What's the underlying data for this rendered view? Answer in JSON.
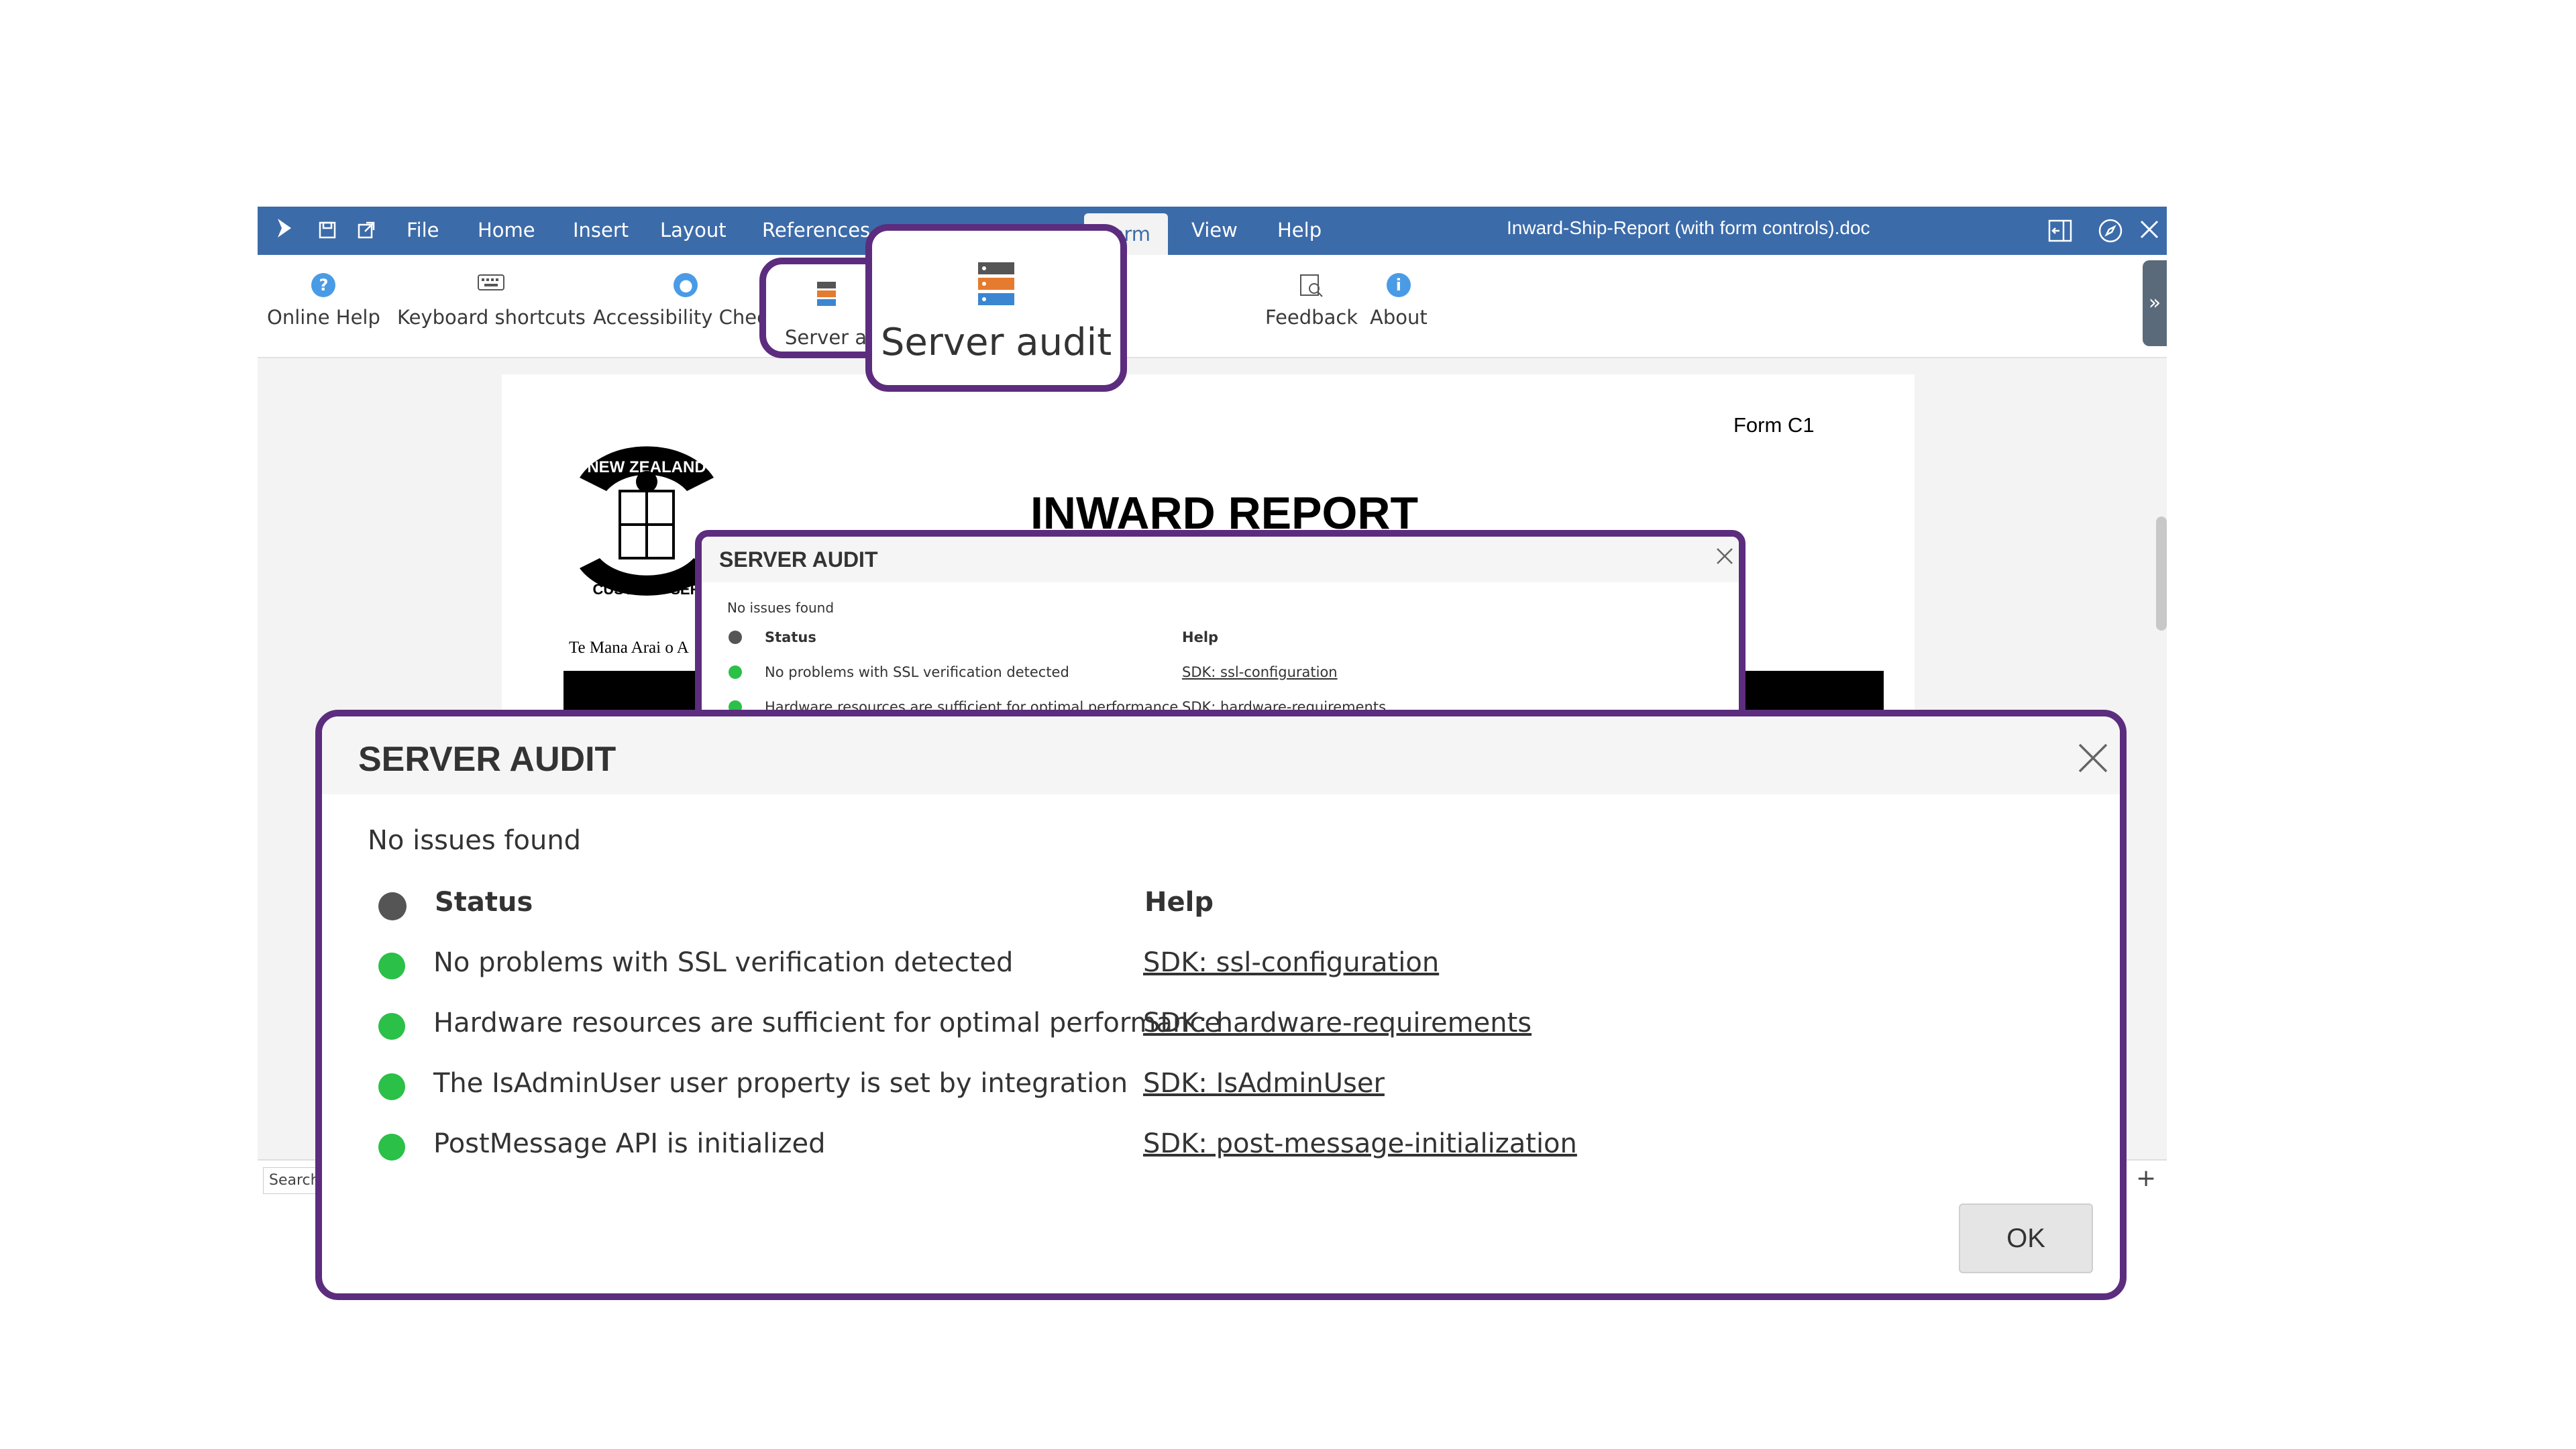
{
  "app": {
    "doc_title": "Inward-Ship-Report (with form controls).doc",
    "menus": [
      "File",
      "Home",
      "Insert",
      "Layout",
      "References",
      "Form",
      "View",
      "Help"
    ],
    "active_menu": "Form",
    "ribbon": {
      "online_help": "Online Help",
      "keyboard_shortcuts": "Keyboard shortcuts",
      "accessibility_check": "Accessibility Check",
      "server_audit_small": "Server au",
      "feedback": "Feedback",
      "about": "About"
    },
    "colors": {
      "titlebar": "#3c6ba9",
      "highlight": "#5c2c7e",
      "status_ok": "#2bc048"
    }
  },
  "callout": {
    "label": "Server audit"
  },
  "document": {
    "form_label": "Form C1",
    "heading": "INWARD REPORT",
    "seal_top": "NEW ZEALAND",
    "seal_bottom": "CUSTOMS SER",
    "motto": "Te Mana Arai o A"
  },
  "bottom": {
    "search_placeholder": "Search",
    "add_label": "+"
  },
  "dialog": {
    "title": "SERVER AUDIT",
    "summary": "No issues found",
    "col_status": "Status",
    "col_help": "Help",
    "rows": [
      {
        "status": "No problems with SSL verification detected",
        "help": "SDK: ssl-configuration"
      },
      {
        "status": "Hardware resources are sufficient for optimal performance",
        "help": "SDK: hardware-requirements"
      },
      {
        "status": "The IsAdminUser user property is set by integration",
        "help": "SDK: IsAdminUser"
      },
      {
        "status": "PostMessage API is initialized",
        "help": "SDK: post-message-initialization"
      }
    ],
    "ok_label": "OK"
  }
}
